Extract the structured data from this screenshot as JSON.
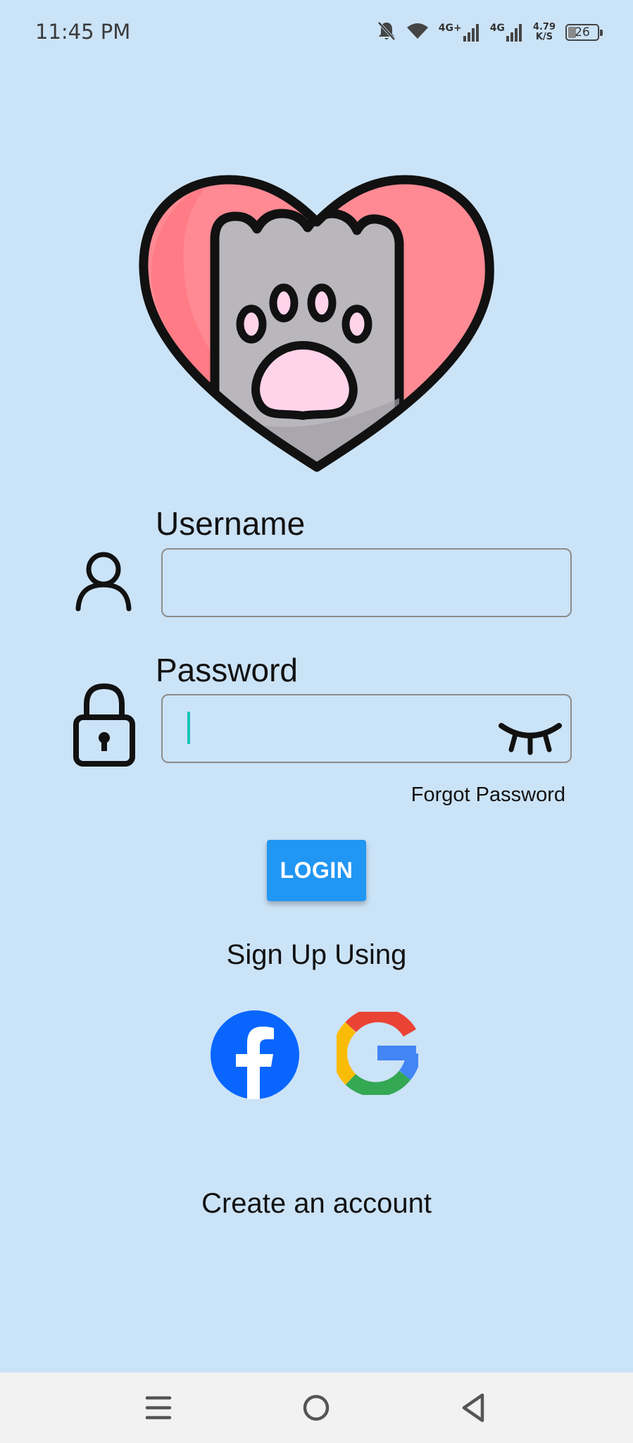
{
  "status_bar": {
    "time": "11:45 PM",
    "network_1": "4G+",
    "network_2": "4G",
    "speed_value": "4.79",
    "speed_unit": "K/S",
    "battery": "26",
    "battery_level_percent": 26,
    "icons": [
      "bell-off-icon",
      "wifi-icon",
      "signal-icon",
      "signal-icon",
      "battery-icon"
    ]
  },
  "form": {
    "username_label": "Username",
    "username_value": "",
    "password_label": "Password",
    "password_value": "",
    "forgot_password": "Forgot Password",
    "login_button": "LOGIN"
  },
  "social": {
    "heading": "Sign Up Using",
    "providers": [
      "facebook-icon",
      "google-icon"
    ]
  },
  "footer": {
    "create_account": "Create an account"
  },
  "navigation": {
    "buttons": [
      "menu-icon",
      "home-icon",
      "back-icon"
    ]
  },
  "colors": {
    "background": "#cbe3f7",
    "login_button": "#2196f3",
    "caret": "#19c3b8",
    "facebook": "#0866ff",
    "heart": "#ff8a93"
  }
}
